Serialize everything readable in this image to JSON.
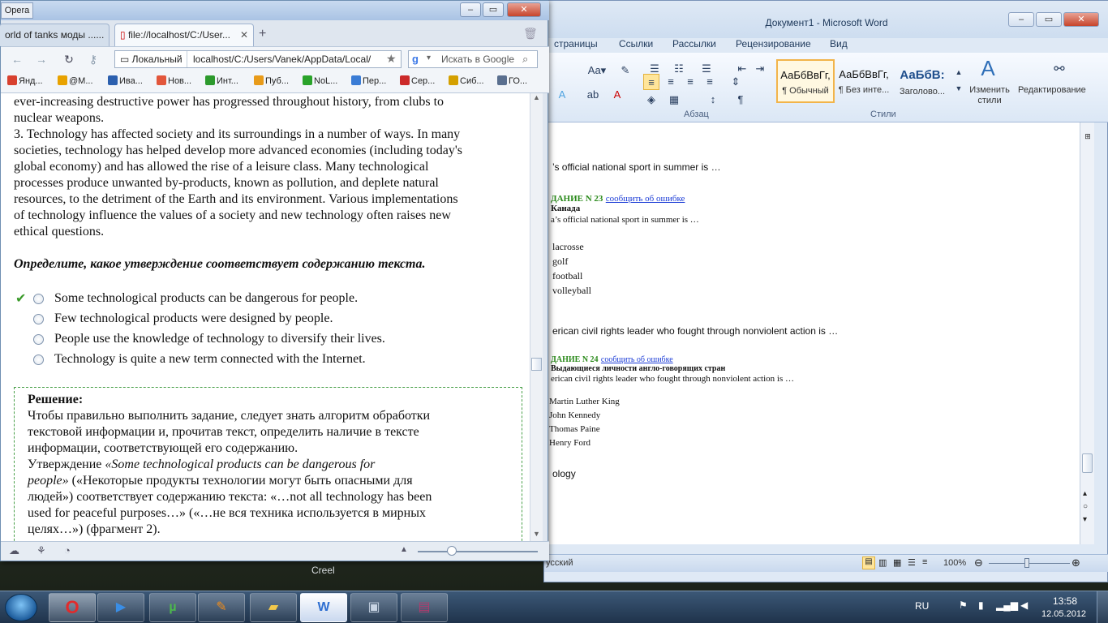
{
  "word": {
    "title": "Документ1 - Microsoft Word",
    "menu": [
      "страницы",
      "Ссылки",
      "Рассылки",
      "Рецензирование",
      "Вид"
    ],
    "groups": {
      "paragraph": "Абзац",
      "styles": "Стили"
    },
    "styles": [
      {
        "sample": "АаБбВвГг,",
        "name": "¶ Обычный"
      },
      {
        "sample": "АаБбВвГг,",
        "name": "¶ Без инте..."
      },
      {
        "sample": "АаБбВ:",
        "name": "Заголово..."
      }
    ],
    "change_styles": "Изменить стили",
    "editing": "Редактирование",
    "status_lang": "усский",
    "zoom": "100%",
    "doc": {
      "line1": "’s official national sport in summer is …",
      "task23": "ДАНИЕ N 23",
      "task23_link": "сообщить об ошибке",
      "task23_topic": "Канада",
      "task23_q": "a’s official national sport in summer is …",
      "task23_opts": [
        "lacrosse",
        "golf",
        "football",
        "volleyball"
      ],
      "line2": "erican civil rights leader who fought through nonviolent action is …",
      "task24": "ДАНИЕ N 24",
      "task24_link": "сообщить об ошибке",
      "task24_topic": "Выдающиеся личности англо-говорящих стран",
      "task24_q": "erican civil rights leader who fought through nonviolent action is …",
      "task24_opts": [
        "Martin Luther King",
        "John Kennedy",
        "Thomas Paine",
        "Henry Ford"
      ],
      "line3": "ology"
    }
  },
  "opera": {
    "badge": "Opera",
    "tabs": [
      {
        "label": "orld of tanks моды ......"
      },
      {
        "label": "file://localhost/C:/User..."
      }
    ],
    "address_label": "Локальный",
    "address": "localhost/C:/Users/Vanek/AppData/Local/",
    "search_placeholder": "Искать в Google",
    "bookmarks": [
      "Янд...",
      "@M...",
      "Ива...",
      "Нов...",
      "Инт...",
      "Пуб...",
      "NoL...",
      "Пер...",
      "Сер...",
      "Сиб...",
      "ГО..."
    ],
    "content": {
      "p2_tail1": "ever-increasing destructive power has progressed throughout history, from clubs to",
      "p2_tail2": "nuclear weapons.",
      "p3": [
        "3. Technology has affected society and its surroundings in a number of ways. In many",
        "societies, technology has helped develop more advanced economies (including today's",
        "global economy) and has allowed the rise of a leisure class. Many technological",
        "processes produce unwanted by-products, known as pollution, and deplete natural",
        "resources, to the detriment of the Earth and its environment. Various implementations",
        "of technology influence the values of a society and new technology often raises new",
        "ethical questions."
      ],
      "prompt": "Определите, какое утверждение соответствует содержанию текста.",
      "options": [
        "Some technological products can be dangerous for people.",
        "Few technological products were designed by people.",
        "People use the knowledge of technology to diversify their lives.",
        "Technology is quite a new term connected with the Internet."
      ],
      "solution": {
        "heading": "Решение:",
        "lines": [
          "Чтобы правильно выполнить задание, следует знать алгоритм обработки",
          "текстовой информации и, прочитав текст, определить наличие в тексте",
          "информации, соответствующей его содержанию."
        ],
        "line4_pre": "Утверждение ",
        "line4_quote": "«Some technological products can be dangerous for",
        "line5_quote": "people»",
        "line5_post": " («Некоторые продукты технологии могут быть опасными для",
        "lines_tail": [
          "людей») соответствует содержанию текста: «…not all technology has been",
          "used for peaceful purposes…» («…не вся техника используется в мирных",
          "целях…») (фрагмент 2)."
        ]
      }
    }
  },
  "desktop_label": "Creel",
  "taskbar": {
    "lang": "RU",
    "time": "13:58",
    "date": "12.05.2012"
  }
}
